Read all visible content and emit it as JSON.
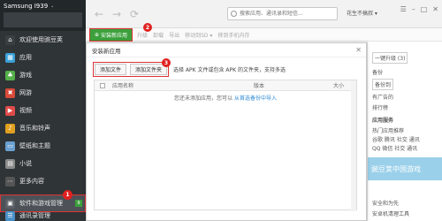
{
  "sidebar": {
    "device_name": "Samsung I939",
    "items": [
      {
        "label": "欢迎使用豌豆荚",
        "icon": "home-icon",
        "color": "#3a3f43"
      },
      {
        "label": "应用",
        "icon": "apps-icon",
        "color": "#3aa0d8"
      },
      {
        "label": "游戏",
        "icon": "game-icon",
        "color": "#56b04a"
      },
      {
        "label": "网游",
        "icon": "online-game-icon",
        "color": "#d84a3a"
      },
      {
        "label": "视频",
        "icon": "video-icon",
        "color": "#e04a4a"
      },
      {
        "label": "音乐和铃声",
        "icon": "music-icon",
        "color": "#e0a020"
      },
      {
        "label": "壁纸和主题",
        "icon": "wallpaper-icon",
        "color": "#6aa0d0"
      },
      {
        "label": "小说",
        "icon": "book-icon",
        "color": "#8a8a8a"
      },
      {
        "label": "更多内容",
        "icon": "more-icon",
        "color": "#555"
      }
    ],
    "active_item": {
      "label": "软件和游戏管理",
      "icon": "package-icon",
      "marker": "1",
      "tag": "9"
    },
    "last_item": {
      "label": "通讯录管理",
      "icon": "contacts-icon"
    }
  },
  "topbar": {
    "search_placeholder": "搜索应用、通讯录和短信...",
    "right_text": "花生不搞叔 ▾"
  },
  "toolbar2": {
    "install_label": "安装新应用",
    "marker": "2",
    "links": [
      "升级",
      "卸载",
      "导出",
      "移动到SD ▾",
      "移到手机内存"
    ]
  },
  "right_panel": {
    "lines": [
      "一键升级 (3)",
      "备份",
      "备份到",
      "有广告的",
      "排行榜",
      "应用服务"
    ],
    "lines_mid": [
      "热门应用推荐",
      "谷歌 腾讯 社交 通讯",
      "QQ 微信 社交 通讯"
    ],
    "banner_text": "豌豆荚中国游戏",
    "footer": "安全和为先",
    "footer2": "安卓机清理工具"
  },
  "dialog": {
    "title": "安装新应用",
    "add_file": "添加文件",
    "add_folder": "添加文件夹",
    "marker": "3",
    "hint": "选择 APK 文件或包含 APK 的文件夹，支持多选",
    "columns": [
      "应用名称",
      "版本",
      "大小"
    ],
    "empty_text": "您还未添加应用，您可以",
    "empty_link": "从首选备份中导入"
  }
}
